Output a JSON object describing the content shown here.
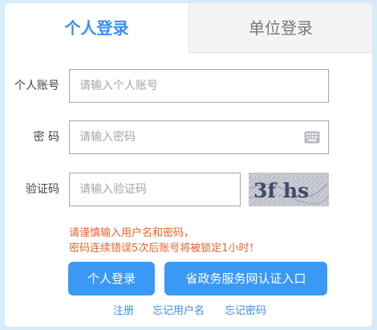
{
  "tabs": {
    "personal": "个人登录",
    "organization": "单位登录"
  },
  "form": {
    "account_label": "个人账号",
    "account_placeholder": "请输入个人账号",
    "password_label": "密 码",
    "password_placeholder": "请输入密码",
    "captcha_label": "验证码",
    "captcha_placeholder": "请输入验证码",
    "captcha_text": "3f hs"
  },
  "notice": {
    "line1": "请谨慎输入用户名和密码，",
    "line2": "密码连续错误5次后账号将被锁定1小时！"
  },
  "buttons": {
    "login": "个人登录",
    "gov_auth": "省政务服务网认证入口"
  },
  "links": {
    "register": "注册",
    "forgot_username": "忘记用户名",
    "forgot_password": "忘记密码"
  },
  "colors": {
    "accent": "#3a99f4",
    "warning": "#e8642a",
    "tab_inactive_bg": "#f2f4f6"
  },
  "icons": {
    "keyboard": "keyboard-icon"
  }
}
